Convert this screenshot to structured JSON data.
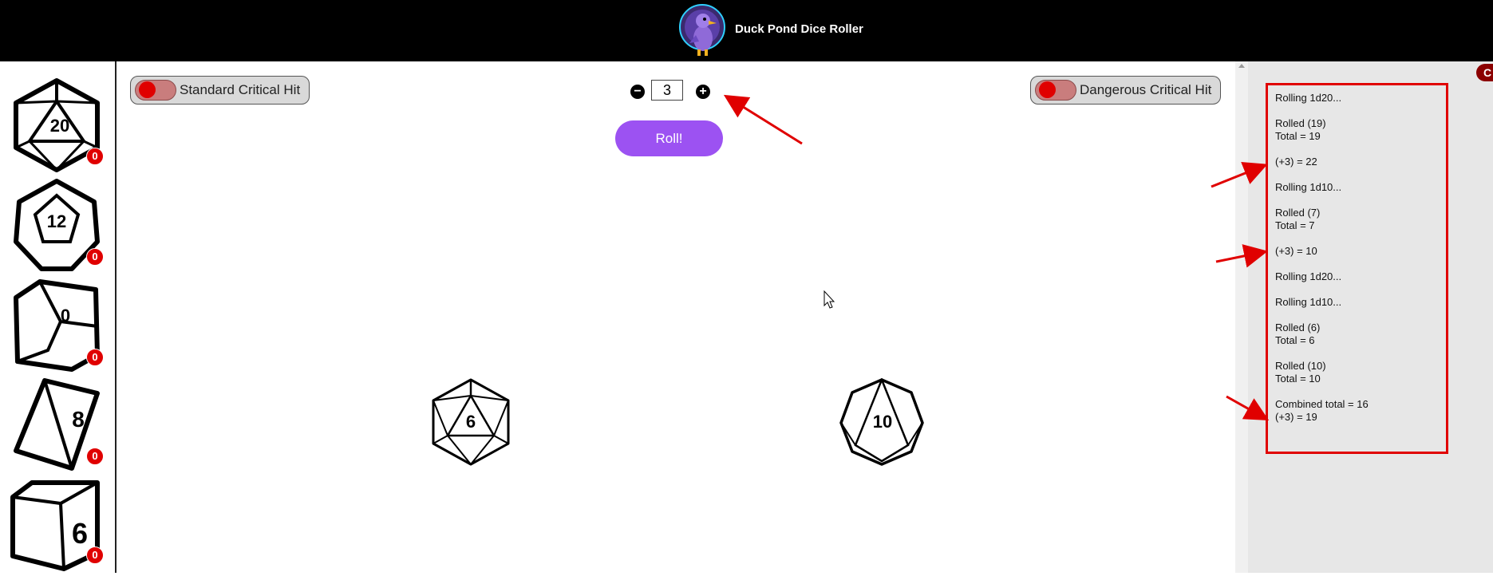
{
  "header": {
    "title": "Duck Pond Dice Roller",
    "logo_icon": "duck-logo-icon"
  },
  "sidebar": {
    "dice": [
      {
        "type": "d20",
        "icon": "d20-icon",
        "count": "0"
      },
      {
        "type": "d12",
        "icon": "d12-icon",
        "count": "0"
      },
      {
        "type": "d10",
        "icon": "d10-icon",
        "count": "0"
      },
      {
        "type": "d8",
        "icon": "d8-icon",
        "count": "0"
      },
      {
        "type": "d6",
        "icon": "d6-icon",
        "count": "0"
      }
    ]
  },
  "controls": {
    "standard_crit_label": "Standard Critical Hit",
    "dangerous_crit_label": "Dangerous Critical Hit",
    "modifier_value": "3",
    "minus_label": "−",
    "plus_label": "+",
    "roll_label": "Roll!"
  },
  "rolled_dice": [
    {
      "type": "d20",
      "value": "6"
    },
    {
      "type": "d10",
      "value": "10"
    }
  ],
  "log": {
    "entries": [
      "Rolling 1d20...",
      "Rolled (19)\nTotal = 19",
      "(+3) = 22",
      "Rolling 1d10...",
      "Rolled (7)\nTotal = 7",
      "(+3) = 10",
      "Rolling 1d20...",
      "Rolling 1d10...",
      "Rolled (6)\nTotal = 6",
      "Rolled (10)\nTotal = 10",
      "Combined total = 16\n(+3) = 19"
    ]
  },
  "corner_badge": "C",
  "colors": {
    "accent_purple": "#9c52f2",
    "badge_red": "#e00000",
    "annotation_red": "#e00000",
    "topbar": "#000000"
  }
}
